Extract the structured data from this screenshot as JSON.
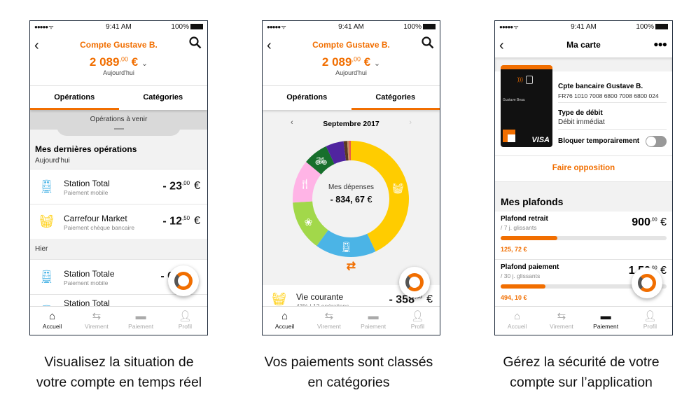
{
  "status": {
    "time": "9:41 AM",
    "battery": "100%"
  },
  "screen1": {
    "title": "Compte Gustave B.",
    "amount_int": "2 089",
    "amount_dec": ",00",
    "currency": "€",
    "date": "Aujourd'hui",
    "tabs": [
      "Opérations",
      "Catégories"
    ],
    "active_tab": 0,
    "upcoming": "Opérations à venir",
    "section_title": "Mes dernières opérations",
    "groups": [
      {
        "label": "Aujourd'hui",
        "items": [
          {
            "icon": "train-icon",
            "name": "Station Total",
            "type": "Paiement mobile",
            "amount_int": "- 23",
            "amount_dec": ",00"
          },
          {
            "icon": "basket-icon",
            "name": "Carrefour Market",
            "type": "Paiement chèque bancaire",
            "amount_int": "- 12",
            "amount_dec": ",50"
          }
        ]
      },
      {
        "label": "Hier",
        "items": [
          {
            "icon": "train-icon",
            "name": "Station Totale",
            "type": "Paiement mobile",
            "amount_int": "- 6",
            "amount_dec": ""
          },
          {
            "icon": "train-icon",
            "name": "Station Total",
            "type": "",
            "amount_int": "",
            "amount_dec": ""
          }
        ]
      }
    ]
  },
  "screen2": {
    "title": "Compte Gustave B.",
    "amount_int": "2 089",
    "amount_dec": ",00",
    "currency": "€",
    "date": "Aujourd'hui",
    "tabs": [
      "Opérations",
      "Catégories"
    ],
    "active_tab": 1,
    "month": "Septembre 2017",
    "donut_label": "Mes dépenses",
    "donut_total": "- 834, 67",
    "category": {
      "name": "Vie courante",
      "detail": "43% | 12 opérations",
      "amount_int": "- 358",
      "amount_dec": ",90"
    }
  },
  "chart_data": {
    "type": "pie",
    "center_label": "Mes dépenses",
    "center_value": "- 834, 67 €",
    "slices": [
      {
        "icon": "basket-icon",
        "value": 43,
        "color": "#ffcc00"
      },
      {
        "icon": "train-icon",
        "value": 17,
        "color": "#4bb4e6"
      },
      {
        "icon": "lotus-icon",
        "value": 14,
        "color": "#a2d84a"
      },
      {
        "icon": "cutlery-icon",
        "value": 12,
        "color": "#ffb4e6"
      },
      {
        "icon": "bike-icon",
        "value": 7,
        "color": "#176f2c"
      },
      {
        "icon": "",
        "value": 5,
        "color": "#50249f"
      },
      {
        "icon": "",
        "value": 1,
        "color": "#5a3a22"
      },
      {
        "icon": "",
        "value": 0.5,
        "color": "#c89060"
      },
      {
        "icon": "",
        "value": 0.5,
        "color": "#e8584a"
      }
    ]
  },
  "screen3": {
    "title": "Ma carte",
    "card": {
      "holder": "Gustave Beau",
      "brand": "VISA",
      "bank_logo": "orange bank"
    },
    "account_label": "Cpte bancaire Gustave B.",
    "iban": "FR76 1010 7008 6800 7008 6800 024",
    "debit_label": "Type de débit",
    "debit_value": "Débit immédiat",
    "block_label": "Bloquer temporairement",
    "block_on": false,
    "opposition": "Faire opposition",
    "limits_title": "Mes plafonds",
    "limits": [
      {
        "name": "Plafond retrait",
        "period": "/ 7 j. glissants",
        "max_int": "900",
        "max_dec": ",00",
        "used": "125, 72 €",
        "fraction": 0.34
      },
      {
        "name": "Plafond paiement",
        "period": "/ 30 j. glissants",
        "max_int": "1.50",
        "max_dec": ",00",
        "used": "494, 10 €",
        "fraction": 0.27
      }
    ]
  },
  "nav": [
    "Accueil",
    "Virement",
    "Paiement",
    "Profil"
  ],
  "captions": [
    [
      "Visualisez la situation de",
      "votre compte en temps réel"
    ],
    [
      "Vos paiements sont classés",
      "en catégories"
    ],
    [
      "Gérez la sécurité de votre",
      "compte sur l’application"
    ]
  ],
  "colors": {
    "accent": "#f16e00",
    "frame": "#1f2b3b"
  }
}
